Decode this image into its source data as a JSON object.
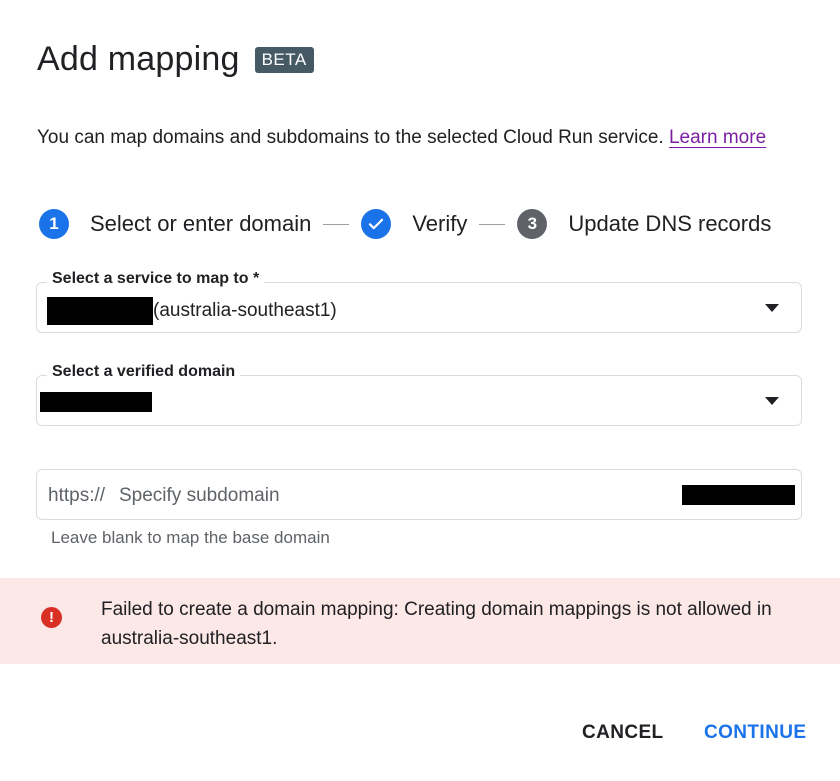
{
  "dialog": {
    "title": "Add mapping",
    "badge": "BETA",
    "description": "You can map domains and subdomains to the selected Cloud Run service.",
    "learn_more": "Learn more"
  },
  "steps": [
    {
      "number": "1",
      "label": "Select or enter domain",
      "state": "active"
    },
    {
      "number": "✓",
      "label": "Verify",
      "state": "done"
    },
    {
      "number": "3",
      "label": "Update DNS records",
      "state": "pending"
    }
  ],
  "service_field": {
    "label": "Select a service to map to *",
    "value_suffix": "(australia-southeast1)"
  },
  "domain_field": {
    "label": "Select a verified domain"
  },
  "subdomain_field": {
    "prefix": "https://",
    "placeholder": "Specify subdomain",
    "hint": "Leave blank to map the base domain"
  },
  "error": {
    "icon": "error-icon",
    "message": "Failed to create a domain mapping: Creating domain mappings is not allowed in australia-southeast1."
  },
  "actions": {
    "cancel": "CANCEL",
    "continue": "CONTINUE"
  },
  "colors": {
    "accent": "#1a73e8",
    "error_bg": "#fce8e6",
    "error_icon": "#d93025",
    "link": "#7b1fa2",
    "badge_bg": "#455a64"
  }
}
